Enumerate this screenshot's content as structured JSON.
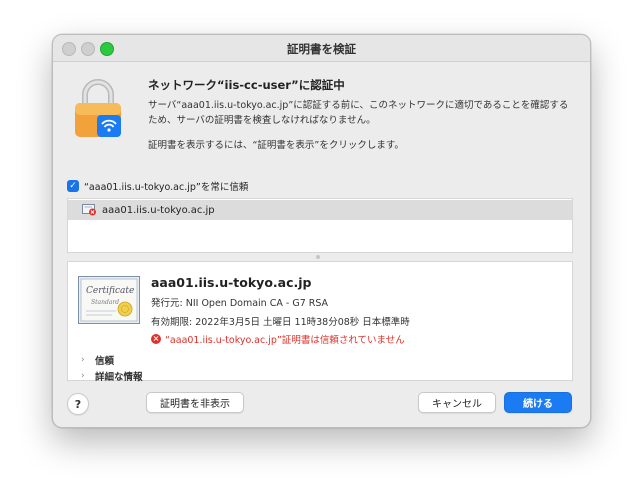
{
  "window": {
    "title": "証明書を検証"
  },
  "header": {
    "heading": "ネットワーク“iis-cc-user”に認証中",
    "description_line1": "サーバ“aaa01.iis.u-tokyo.ac.jp”に認証する前に、このネットワークに適切であることを確認する",
    "description_line2": "ため、サーバの証明書を検査しなければなりません。",
    "hint": "証明書を表示するには、“証明書を表示”をクリックします。"
  },
  "trust_checkbox": {
    "label": "“aaa01.iis.u-tokyo.ac.jp”を常に信頼",
    "checked": true
  },
  "cert_list": {
    "items": [
      {
        "name": "aaa01.iis.u-tokyo.ac.jp"
      }
    ]
  },
  "certificate": {
    "name": "aaa01.iis.u-tokyo.ac.jp",
    "issuer": "発行元: NII Open Domain CA - G7 RSA",
    "expires": "有効期限: 2022年3月5日 土曜日 11時38分08秒 日本標準時",
    "error": "“aaa01.iis.u-tokyo.ac.jp”証明書は信頼されていません",
    "image_text_1": "Certificate",
    "image_text_2": "Standard"
  },
  "sections": {
    "trust": "信頼",
    "details": "詳細な情報"
  },
  "buttons": {
    "help": "?",
    "hide_cert": "証明書を非表示",
    "cancel": "キャンセル",
    "continue": "続ける"
  },
  "colors": {
    "accent": "#1a7bf2",
    "error": "#e0302a",
    "lock": "#f2a23a"
  }
}
